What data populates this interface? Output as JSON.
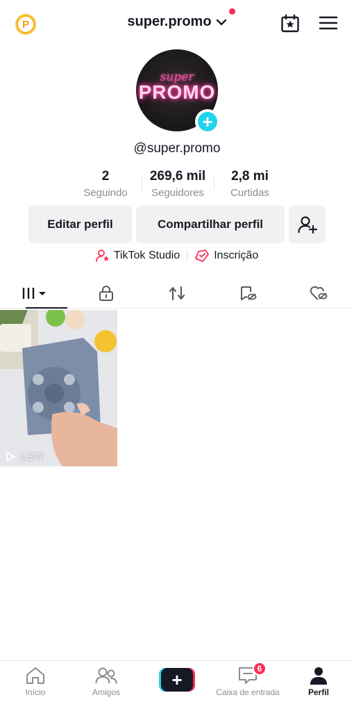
{
  "header": {
    "coin_label": "P",
    "username": "super.promo",
    "notification_dot_color": "#fe2c55"
  },
  "profile": {
    "avatar_text_top": "super",
    "avatar_text_main": "PROMO",
    "handle": "@super.promo",
    "add_badge": "+"
  },
  "stats": [
    {
      "value": "2",
      "label": "Seguindo"
    },
    {
      "value": "269,6 mil",
      "label": "Seguidores"
    },
    {
      "value": "2,8 mi",
      "label": "Curtidas"
    }
  ],
  "actions": {
    "edit": "Editar perfil",
    "share": "Compartilhar perfil"
  },
  "links": {
    "studio": "TikTok Studio",
    "subscription": "Inscrição"
  },
  "tabs": [
    "videos-grid-icon",
    "lock-icon",
    "repost-icon",
    "hidden-icon",
    "liked-hidden-icon"
  ],
  "videos": [
    {
      "plays": "1.577"
    }
  ],
  "bottom_nav": {
    "home": "Início",
    "friends": "Amigos",
    "create": "+",
    "inbox": "Caixa de entrada",
    "inbox_badge": "6",
    "profile": "Perfil"
  },
  "colors": {
    "accent_red": "#fe2c55",
    "accent_cyan": "#20d5ec",
    "button_bg": "#f1f1f2"
  }
}
